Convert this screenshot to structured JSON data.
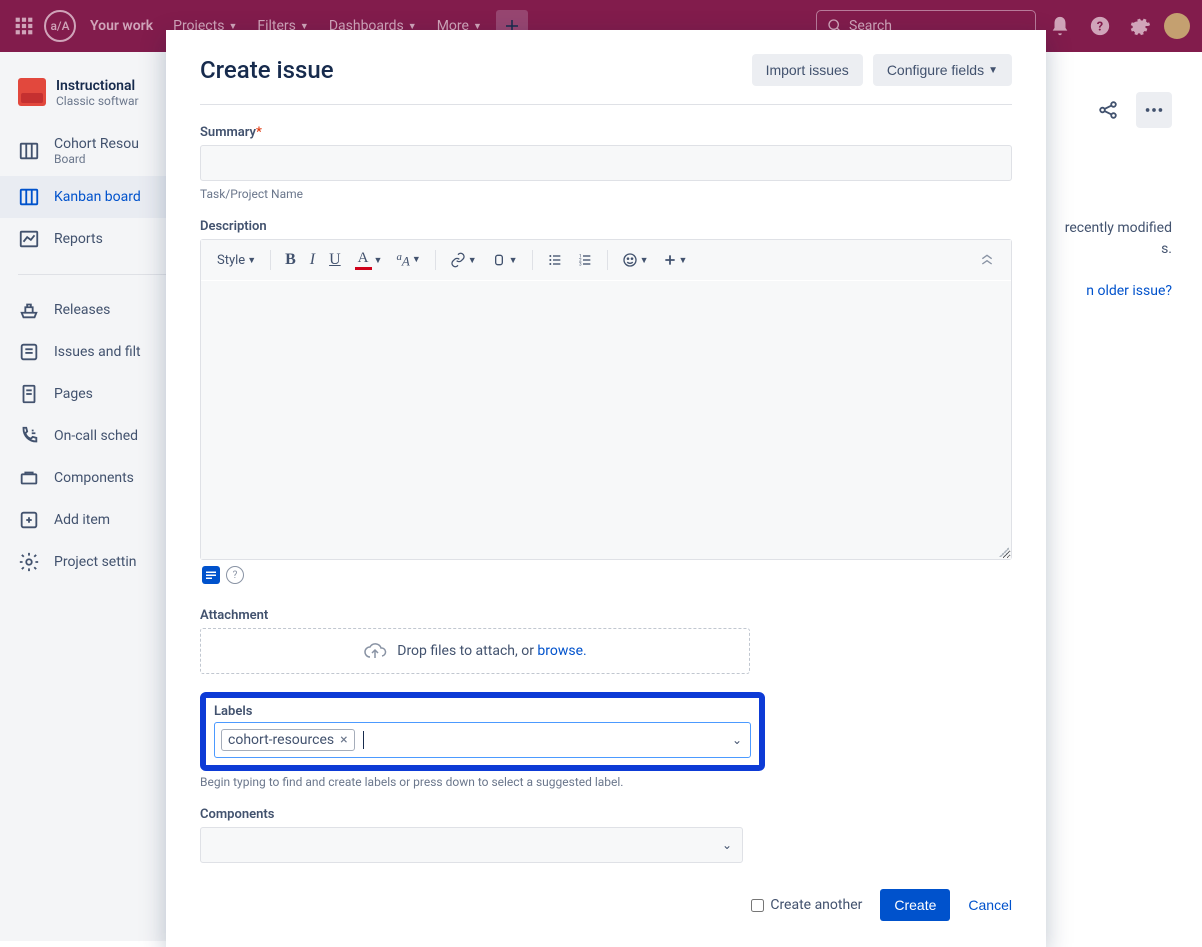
{
  "topnav": {
    "items": [
      "Your work",
      "Projects",
      "Filters",
      "Dashboards",
      "More"
    ],
    "search_placeholder": "Search",
    "logo_text": "a/A"
  },
  "sidebar": {
    "project_name": "Instructional",
    "project_type": "Classic softwar",
    "board": {
      "title": "Cohort Resou",
      "sub": "Board"
    },
    "kanban": "Kanban board",
    "reports": "Reports",
    "items": [
      "Releases",
      "Issues and filt",
      "Pages",
      "On-call sched",
      "Components",
      "Add item",
      "Project settin"
    ]
  },
  "background": {
    "hint1": "recently modified",
    "hint2": "s.",
    "hint_link": "n older issue?"
  },
  "modal": {
    "title": "Create issue",
    "import_btn": "Import issues",
    "configure_btn": "Configure fields",
    "summary_label": "Summary",
    "summary_helper": "Task/Project Name",
    "description_label": "Description",
    "style_btn": "Style",
    "attachment_label": "Attachment",
    "attach_text": "Drop files to attach, or ",
    "attach_link": "browse.",
    "labels_label": "Labels",
    "label_chip": "cohort-resources",
    "labels_helper": "Begin typing to find and create labels or press down to select a suggested label.",
    "components_label": "Components",
    "create_another": "Create another",
    "create_btn": "Create",
    "cancel_btn": "Cancel"
  }
}
